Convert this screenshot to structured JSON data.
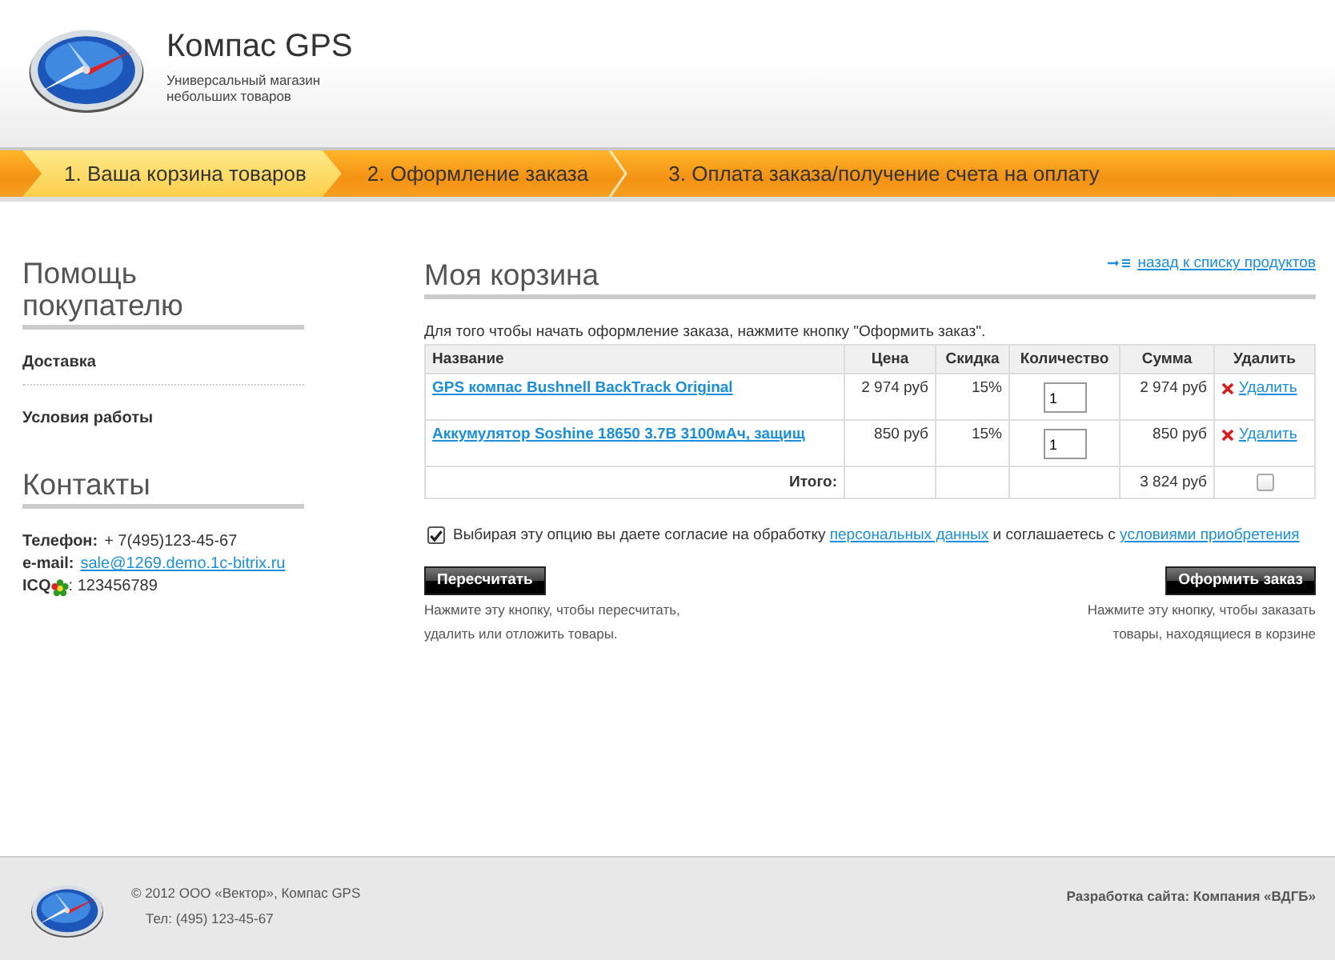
{
  "header": {
    "title": "Компас GPS",
    "tagline_lines": [
      "Универсальный магазин",
      "небольших товаров"
    ]
  },
  "steps": [
    {
      "label": "1. Ваша корзина товаров",
      "selected": true
    },
    {
      "label": "2. Оформление заказа",
      "selected": false
    },
    {
      "label": "3. Оплата заказа/получение счета на оплату",
      "selected": false
    }
  ],
  "sidebar": {
    "help_title": "Помощь покупателю",
    "links": [
      "Доставка",
      "Условия работы"
    ],
    "contacts_title": "Контакты",
    "contacts": [
      {
        "label": "Телефон:",
        "value": "+ 7(495)123-45-67",
        "kind": "text"
      },
      {
        "label": "e-mail:",
        "value": "sale@1269.demo.1c-bitrix.ru",
        "kind": "link"
      },
      {
        "label": "ICQ",
        "value": ": 123456789",
        "kind": "icq"
      }
    ]
  },
  "cart": {
    "title": "Моя корзина",
    "back_link": "назад к списку продуктов",
    "instruction": "Для того чтобы начать оформление заказа, нажмите кнопку \"Оформить заказ\".",
    "columns": [
      "Название",
      "Цена",
      "Скидка",
      "Количество",
      "Сумма",
      "Удалить"
    ],
    "rows": [
      {
        "name": "GPS компас Bushnell BackTrack Original",
        "price": "2 974 руб",
        "discount": "15%",
        "quantity": "1",
        "sum": "2 974 руб",
        "delete": "Удалить"
      },
      {
        "name": "Аккумулятор Soshine 18650 3.7В 3100мАч, защищ",
        "price": "850 руб",
        "discount": "15%",
        "quantity": "1",
        "sum": "850 руб",
        "delete": "Удалить"
      }
    ],
    "total": {
      "label": "Итого:",
      "sum": "3 824 руб",
      "checked": false
    },
    "consent": {
      "checked": true,
      "parts": [
        {
          "kind": "text",
          "text": "Выбирая эту опцию вы даете согласие на обработку "
        },
        {
          "kind": "link",
          "text": "персональных данных"
        },
        {
          "kind": "text",
          "text": " и соглашаетесь с "
        },
        {
          "kind": "link",
          "text": "условиями приобретения"
        }
      ]
    },
    "buttons": [
      {
        "label": "Пересчитать",
        "hint_lines": [
          "Нажмите эту кнопку, чтобы пересчитать,",
          "удалить или отложить товары."
        ]
      },
      {
        "label": "Оформить заказ",
        "hint_lines": [
          "Нажмите эту кнопку, чтобы заказать",
          "товары, находящиеся в корзине"
        ]
      }
    ]
  },
  "footer": {
    "copyright": "© 2012 ООО «Вектор», Компас GPS",
    "phone": "Тел: (495) 123-45-67",
    "developer": "Разработка сайта: Компания «ВДГБ»"
  }
}
